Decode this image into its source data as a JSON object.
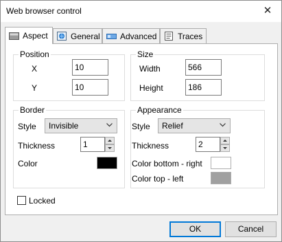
{
  "window": {
    "title": "Web browser control",
    "close": "✕"
  },
  "tabs": [
    {
      "label": "Aspect",
      "icon": "aspect-icon",
      "active": true
    },
    {
      "label": "General",
      "icon": "globe-icon",
      "active": false
    },
    {
      "label": "Advanced",
      "icon": "advanced-icon",
      "active": false
    },
    {
      "label": "Traces",
      "icon": "traces-icon",
      "active": false
    }
  ],
  "position": {
    "label": "Position",
    "x_label": "X",
    "x_value": "10",
    "y_label": "Y",
    "y_value": "10"
  },
  "size": {
    "label": "Size",
    "width_label": "Width",
    "width_value": "566",
    "height_label": "Height",
    "height_value": "186"
  },
  "border": {
    "label": "Border",
    "style_label": "Style",
    "style_value": "Invisible",
    "thickness_label": "Thickness",
    "thickness_value": "1",
    "color_label": "Color",
    "color_value": "#000000"
  },
  "appearance": {
    "label": "Appearance",
    "style_label": "Style",
    "style_value": "Relief",
    "thickness_label": "Thickness",
    "thickness_value": "2",
    "color_bottom_right_label": "Color bottom - right",
    "color_bottom_right_value": "#ffffff",
    "color_top_left_label": "Color top - left",
    "color_top_left_value": "#a0a0a0"
  },
  "locked": {
    "label": "Locked",
    "checked": false
  },
  "buttons": {
    "ok": "OK",
    "cancel": "Cancel"
  }
}
